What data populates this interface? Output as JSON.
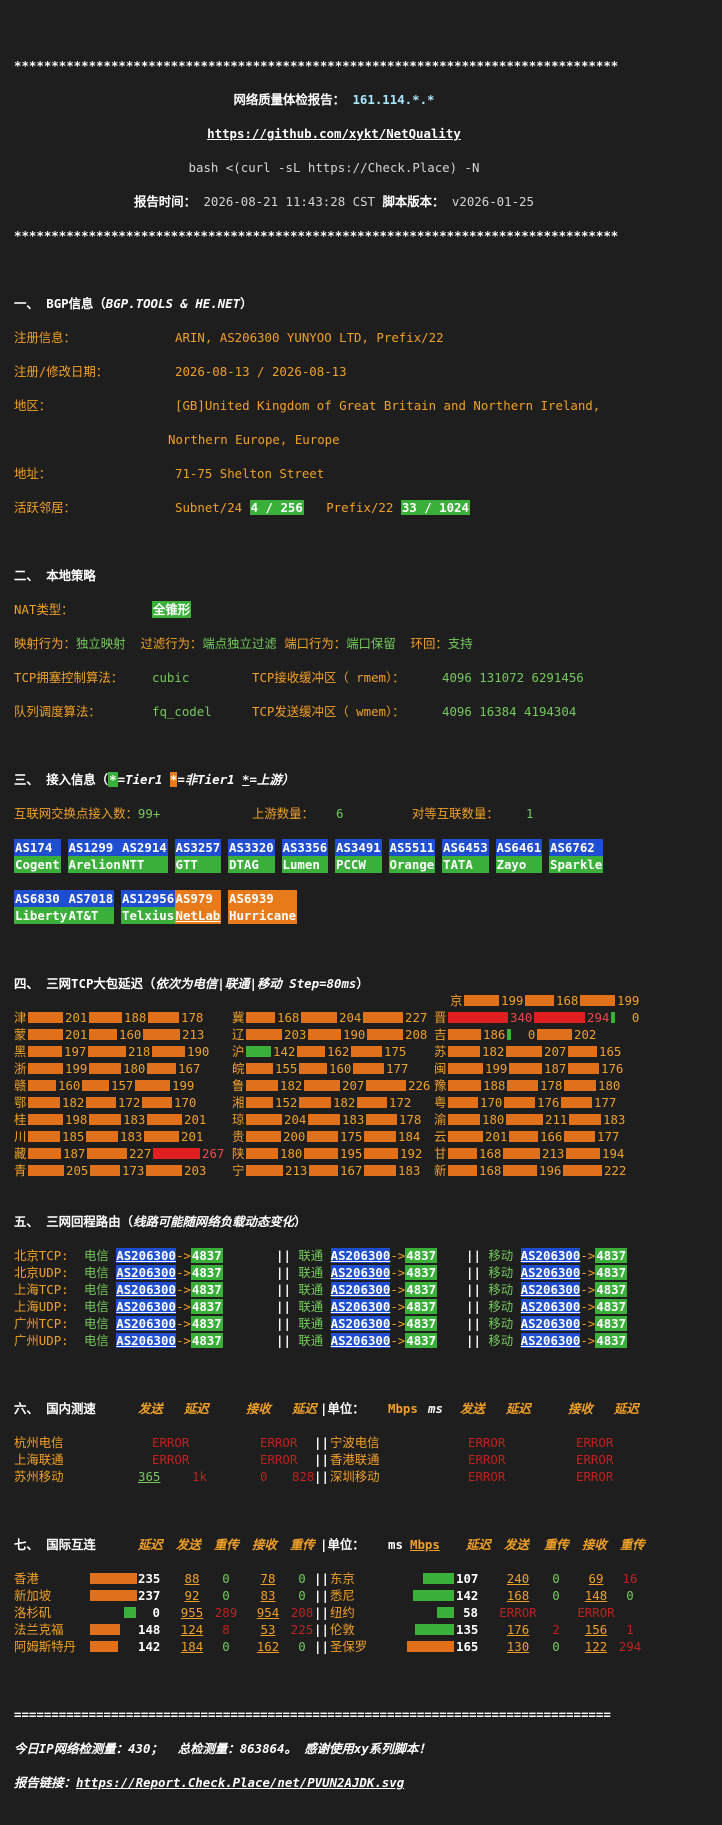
{
  "header": {
    "stars": "*********************************************************************************",
    "title_label": "网络质量体检报告：",
    "ip": "161.114.*.*",
    "repo_url": "https://github.com/xykt/NetQuality",
    "command": "bash <(curl -sL https://Check.Place) -N",
    "report_time_label": "报告时间：",
    "report_time": "2026-08-21 11:43:28 CST",
    "script_version_label": "脚本版本：",
    "script_version": "v2026-01-25"
  },
  "bgp": {
    "section_title": "一、 BGP信息（",
    "section_source": "BGP.TOOLS & HE.NET",
    "section_close": "）",
    "registration_label": "注册信息：",
    "registration": "ARIN, AS206300 YUNYOO LTD, Prefix/22",
    "dates_label": "注册/修改日期：",
    "dates": "2026-08-13 / 2026-08-13",
    "region_label": "地区：",
    "region_line1": "[GB]United Kingdom of Great Britain and Northern Ireland,",
    "region_line2": "Northern Europe, Europe",
    "address_label": "地址：",
    "address": "71-75 Shelton Street",
    "neighbors_label": "活跃邻居：",
    "subnet_label": "Subnet/24",
    "subnet_value": "4 / 256",
    "prefix_label": "Prefix/22",
    "prefix_value": "33 / 1024"
  },
  "local": {
    "section_title": "二、 本地策略",
    "nat_label": "NAT类型：",
    "nat_value": "全锥形",
    "mapping_label": "映射行为：",
    "mapping_value": "独立映射",
    "filter_label": "过滤行为：",
    "filter_value": "端点独立过滤",
    "port_label": "端口行为：",
    "port_value": "端口保留",
    "hairpin_label": "环回：",
    "hairpin_value": "支持",
    "cc_label": "TCP拥塞控制算法：",
    "cc_value": "cubic",
    "rmem_label": "TCP接收缓冲区（ rmem）：",
    "rmem_value": "4096 131072 6291456",
    "qdisc_label": "队列调度算法：",
    "qdisc_value": "fq_codel",
    "wmem_label": "TCP发送缓冲区（ wmem）：",
    "wmem_value": "4096 16384 4194304"
  },
  "access": {
    "section_title": "三、 接入信息（",
    "legend1_mark": "*",
    "legend1": "=Tier1",
    "legend2_mark": "*",
    "legend2": "=非Tier1",
    "legend3_mark": "*",
    "legend3": "=上游）",
    "ix_label": "互联网交换点接入数：",
    "ix_value": "99+",
    "upstream_label": "上游数量：",
    "upstream_value": "6",
    "peer_label": "对等互联数量：",
    "peer_value": "1",
    "row1": [
      {
        "as": "AS174",
        "name": "Cogent",
        "kind": "tier1"
      },
      {
        "as": "AS1299",
        "name": "Arelion",
        "kind": "tier1"
      },
      {
        "as": "AS2914",
        "name": "NTT",
        "kind": "tier1"
      },
      {
        "as": "AS3257",
        "name": "GTT",
        "kind": "tier1"
      },
      {
        "as": "AS3320",
        "name": "DTAG",
        "kind": "tier1"
      },
      {
        "as": "AS3356",
        "name": "Lumen",
        "kind": "tier1"
      },
      {
        "as": "AS3491",
        "name": "PCCW",
        "kind": "tier1"
      },
      {
        "as": "AS5511",
        "name": "Orange",
        "kind": "tier1"
      },
      {
        "as": "AS6453",
        "name": "TATA",
        "kind": "tier1"
      },
      {
        "as": "AS6461",
        "name": "Zayo",
        "kind": "tier1"
      },
      {
        "as": "AS6762",
        "name": "Sparkle",
        "kind": "tier1"
      }
    ],
    "row2": [
      {
        "as": "AS6830",
        "name": "Liberty",
        "kind": "tier1"
      },
      {
        "as": "AS7018",
        "name": "AT&T",
        "kind": "tier1"
      },
      {
        "as": "AS12956",
        "name": "Telxius",
        "kind": "tier1"
      },
      {
        "as": "AS979",
        "name": "NetLab",
        "kind": "upstream"
      },
      {
        "as": "AS6939",
        "name": "Hurricane",
        "kind": "upstream"
      }
    ]
  },
  "latency": {
    "section_title": "四、 三网TCP大包延迟（",
    "section_note": "依次为电信|联通|移动 Step=80ms",
    "section_close": "）",
    "columns": [
      [
        {
          "p": "京",
          "v": [
            "199",
            "168",
            "199"
          ]
        },
        {
          "p": "津",
          "v": [
            "201",
            "188",
            "178"
          ]
        },
        {
          "p": "蒙",
          "v": [
            "201",
            "160",
            "213"
          ]
        },
        {
          "p": "黑",
          "v": [
            "197",
            "218",
            "190"
          ]
        },
        {
          "p": "浙",
          "v": [
            "199",
            "180",
            "167"
          ]
        },
        {
          "p": "赣",
          "v": [
            "160",
            "157",
            "199"
          ]
        },
        {
          "p": "鄂",
          "v": [
            "182",
            "172",
            "170"
          ]
        },
        {
          "p": "桂",
          "v": [
            "198",
            "183",
            "201"
          ]
        },
        {
          "p": "川",
          "v": [
            "185",
            "183",
            "201"
          ]
        },
        {
          "p": "藏",
          "v": [
            "187",
            "227",
            "267"
          ]
        },
        {
          "p": "青",
          "v": [
            "205",
            "173",
            "203"
          ]
        }
      ],
      [
        {
          "p": "冀",
          "v": [
            "168",
            "204",
            "227"
          ]
        },
        {
          "p": "辽",
          "v": [
            "203",
            "190",
            "208"
          ]
        },
        {
          "p": "沪",
          "v": [
            "142",
            "162",
            "175"
          ]
        },
        {
          "p": "皖",
          "v": [
            "155",
            "160",
            "177"
          ]
        },
        {
          "p": "鲁",
          "v": [
            "182",
            "207",
            "226"
          ]
        },
        {
          "p": "湘",
          "v": [
            "152",
            "182",
            "172"
          ]
        },
        {
          "p": "琼",
          "v": [
            "204",
            "183",
            "178"
          ]
        },
        {
          "p": "贵",
          "v": [
            "200",
            "175",
            "184"
          ]
        },
        {
          "p": "陕",
          "v": [
            "180",
            "195",
            "192"
          ]
        },
        {
          "p": "宁",
          "v": [
            "213",
            "167",
            "183"
          ]
        }
      ],
      [
        {
          "p": "晋",
          "v": [
            "340",
            "294",
            "0"
          ]
        },
        {
          "p": "吉",
          "v": [
            "186",
            "0",
            "202"
          ]
        },
        {
          "p": "苏",
          "v": [
            "182",
            "207",
            "165"
          ]
        },
        {
          "p": "闽",
          "v": [
            "199",
            "187",
            "176"
          ]
        },
        {
          "p": "豫",
          "v": [
            "188",
            "178",
            "180"
          ]
        },
        {
          "p": "粤",
          "v": [
            "170",
            "176",
            "177"
          ]
        },
        {
          "p": "渝",
          "v": [
            "180",
            "211",
            "183"
          ]
        },
        {
          "p": "云",
          "v": [
            "201",
            "166",
            "177"
          ]
        },
        {
          "p": "甘",
          "v": [
            "168",
            "213",
            "194"
          ]
        },
        {
          "p": "新",
          "v": [
            "168",
            "196",
            "222"
          ]
        }
      ]
    ]
  },
  "routes": {
    "section_title": "五、 三网回程路由（",
    "section_note": "线路可能随网络负载动态变化",
    "section_close": "）",
    "ct": "电信",
    "cu": "联通",
    "cm": "移动",
    "as_from": "AS206300",
    "arrow": "->",
    "as_to": "4837",
    "rows": [
      "北京TCP:",
      "北京UDP:",
      "上海TCP:",
      "上海UDP:",
      "广州TCP:",
      "广州UDP:"
    ]
  },
  "domestic": {
    "section_title": "六、 国内测速",
    "h_send": "发送",
    "h_delay": "延迟",
    "h_recv": "接收",
    "h_unit": "|单位：",
    "h_mbps": "Mbps",
    "h_ms": "ms",
    "rows": [
      {
        "l": "杭州电信",
        "err": "ERROR",
        "r": "宁波电信"
      },
      {
        "l": "上海联通",
        "err": "ERROR",
        "r": "香港联通"
      },
      {
        "l": "苏州移动",
        "send": "365",
        "delay": "1k",
        "recv": "0",
        "recv_delay": "828",
        "r": "深圳移动"
      }
    ]
  },
  "intl": {
    "section_title": "七、 国际互连",
    "h_delay": "延迟",
    "h_send": "发送",
    "h_retx": "重传",
    "h_recv": "接收",
    "h_unit": "|单位：",
    "h_ms": "ms",
    "h_mbps": "Mbps",
    "rows": [
      {
        "l": "香港",
        "ld": "235",
        "ls": "88",
        "lr": "0",
        "lv": "78",
        "lr2": "0",
        "r": "东京",
        "rd": "107",
        "rs": "240",
        "rr": "0",
        "rv": "69",
        "rr2": "16"
      },
      {
        "l": "新加坡",
        "ld": "237",
        "ls": "92",
        "lr": "0",
        "lv": "83",
        "lr2": "0",
        "r": "悉尼",
        "rd": "142",
        "rs": "168",
        "rr": "0",
        "rv": "148",
        "rr2": "0"
      },
      {
        "l": "洛杉矶",
        "ld": "0",
        "ls": "955",
        "lr": "289",
        "lv": "954",
        "lr2": "208",
        "r": "纽约",
        "rd": "58",
        "rs": "ERROR",
        "rr": "",
        "rv": "ERROR",
        "rr2": ""
      },
      {
        "l": "法兰克福",
        "ld": "148",
        "ls": "124",
        "lr": "8",
        "lv": "53",
        "lr2": "225",
        "r": "伦敦",
        "rd": "135",
        "rs": "176",
        "rr": "2",
        "rv": "156",
        "rr2": "1"
      },
      {
        "l": "阿姆斯特丹",
        "ld": "142",
        "ls": "184",
        "lr": "0",
        "lv": "162",
        "lr2": "0",
        "r": "圣保罗",
        "rd": "165",
        "rs": "130",
        "rr": "0",
        "rv": "122",
        "rr2": "294"
      }
    ]
  },
  "footer": {
    "line": "================================================================================",
    "today_label": "今日IP网络检测量：",
    "today": "430",
    "total_label": "总检测量：",
    "total": "863864",
    "thanks": "感谢使用xy系列脚本！",
    "report_label": "报告链接：",
    "report_url": "https://Report.Check.Place/net/PVUN2AJDK.svg"
  }
}
